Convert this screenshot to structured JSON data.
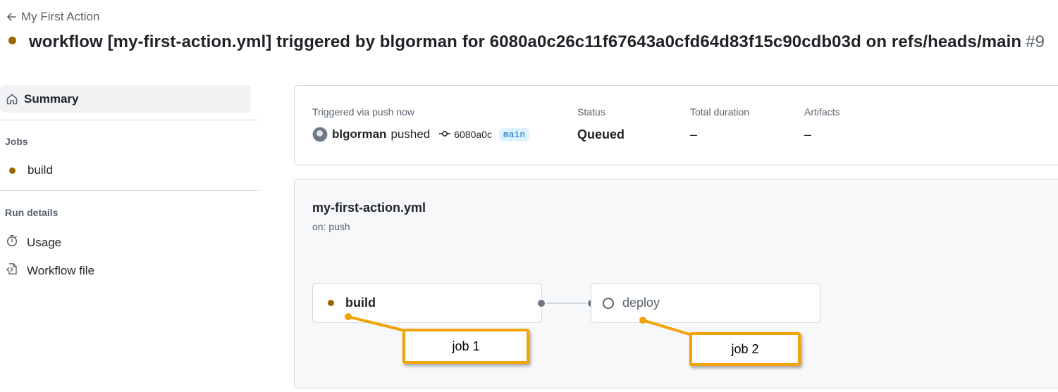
{
  "header": {
    "back_label": "My First Action",
    "title": "workflow [my-first-action.yml] triggered by blgorman for 6080a0c26c11f67643a0cfd64d83f15c90cdb03d on refs/heads/main",
    "run_number": "#9",
    "status_color": "#9a6700"
  },
  "sidebar": {
    "summary_label": "Summary",
    "jobs_heading": "Jobs",
    "jobs": [
      {
        "label": "build",
        "status": "in-progress"
      }
    ],
    "run_details_heading": "Run details",
    "run_details": [
      {
        "label": "Usage",
        "icon": "stopwatch-icon"
      },
      {
        "label": "Workflow file",
        "icon": "file-code-icon"
      }
    ]
  },
  "run_info": {
    "trigger_label": "Triggered via push now",
    "actor": "blgorman",
    "action": "pushed",
    "commit": "6080a0c",
    "branch": "main",
    "status_label": "Status",
    "status_value": "Queued",
    "duration_label": "Total duration",
    "duration_value": "–",
    "artifacts_label": "Artifacts",
    "artifacts_value": "–"
  },
  "graph": {
    "workflow_name": "my-first-action.yml",
    "trigger": "on: push",
    "jobs": [
      {
        "label": "build",
        "status": "in-progress"
      },
      {
        "label": "deploy",
        "status": "queued"
      }
    ]
  },
  "annotations": [
    {
      "label": "job 1"
    },
    {
      "label": "job 2"
    }
  ],
  "colors": {
    "accent_callout": "#f0a30a",
    "in_progress": "#9a6700",
    "branch_bg": "#ddf4ff",
    "branch_fg": "#0969da"
  }
}
